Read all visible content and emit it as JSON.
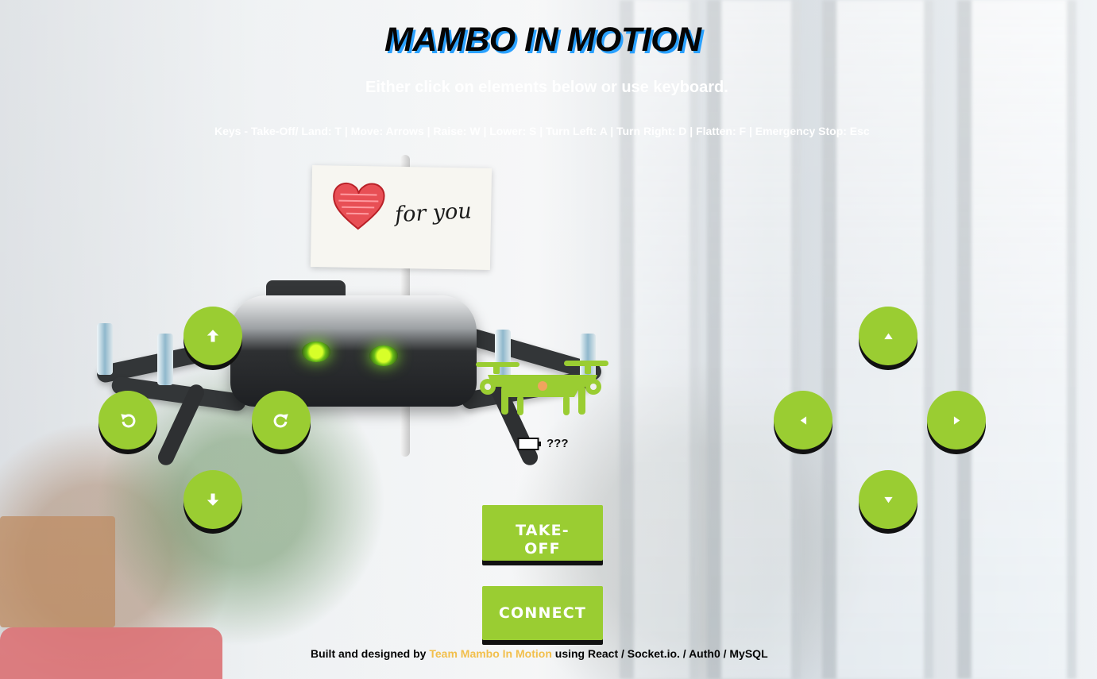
{
  "header": {
    "title": "MAMBO IN MOTION",
    "subtitle": "Either click on elements below or use keyboard.",
    "keys": "Keys - Take-Off/ Land: T | Move: Arrows | Raise: W | Lower: S | Turn Left: A | Turn Right: D | Flatten: F | Emergency Stop: Esc"
  },
  "controls": {
    "move_forward_icon": "arrow-up-icon",
    "turn_left_icon": "rotate-left-icon",
    "turn_right_icon": "rotate-right-icon",
    "move_back_icon": "arrow-down-icon",
    "raise_icon": "triangle-up-icon",
    "left_icon": "triangle-left-icon",
    "right_icon": "triangle-right-icon",
    "lower_icon": "triangle-down-icon"
  },
  "status": {
    "battery": "???"
  },
  "buttons": {
    "takeoff": "TAKE-\nOFF",
    "connect": "CONNECT"
  },
  "footer": {
    "prefix": "Built and designed by ",
    "team": "Team Mambo In Motion",
    "suffix": " using React / Socket.io. / Auth0 / MySQL"
  },
  "colors": {
    "accent": "#9acd32",
    "title_shadow": "#2aa1ff",
    "link": "#f2bf4c"
  }
}
